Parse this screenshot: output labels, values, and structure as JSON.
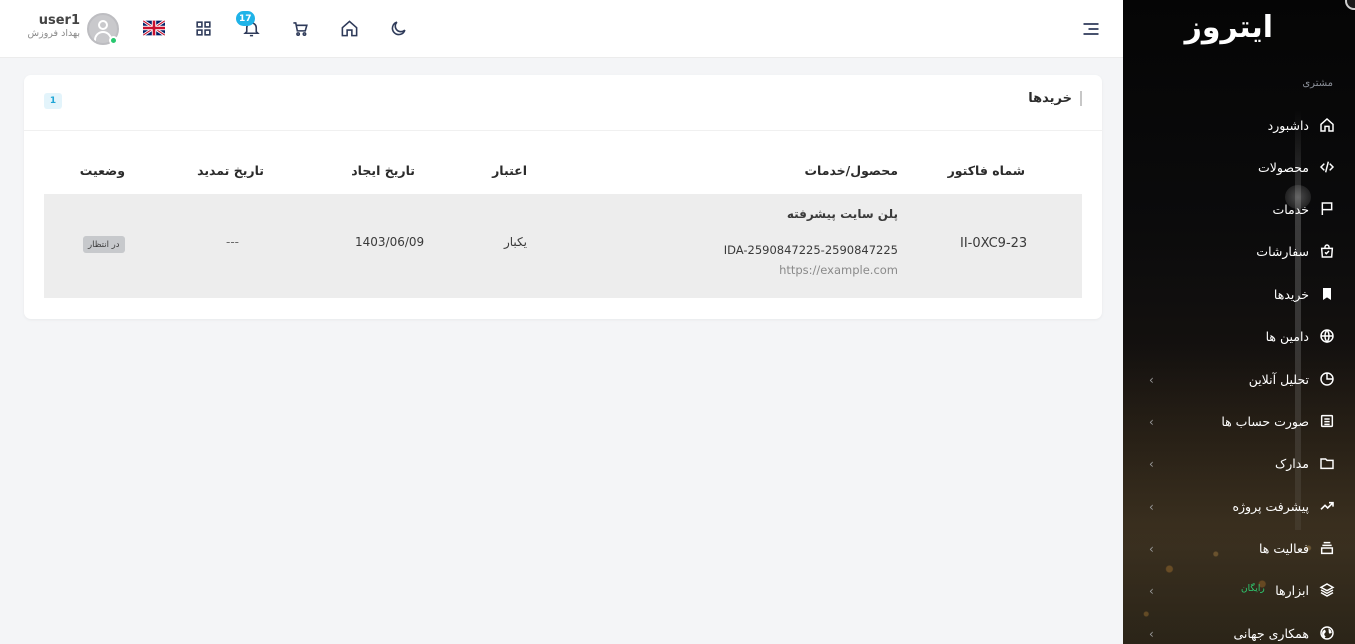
{
  "sidebar": {
    "logo": "ایتروز",
    "section_label": "مشتری",
    "items": [
      {
        "label": "داشبورد",
        "icon": "home-icon",
        "chevron": false
      },
      {
        "label": "محصولات",
        "icon": "code-icon",
        "chevron": false
      },
      {
        "label": "خدمات",
        "icon": "flag-icon",
        "chevron": false
      },
      {
        "label": "سفارشات",
        "icon": "shopping-bag-icon",
        "chevron": false
      },
      {
        "label": "خریدها",
        "icon": "bookmark-icon",
        "chevron": false
      },
      {
        "label": "دامین ها",
        "icon": "globe-icon",
        "chevron": false
      },
      {
        "label": "تحلیل آنلاین",
        "icon": "pie-chart-icon",
        "chevron": true
      },
      {
        "label": "صورت حساب ها",
        "icon": "invoice-icon",
        "chevron": true
      },
      {
        "label": "مدارک",
        "icon": "folder-icon",
        "chevron": true
      },
      {
        "label": "پیشرفت پروژه",
        "icon": "trending-up-icon",
        "chevron": true
      },
      {
        "label": "فعالیت ها",
        "icon": "archive-icon",
        "chevron": true
      },
      {
        "label": "ابزارها",
        "icon": "layers-icon",
        "chevron": true,
        "badge": "رایگان"
      },
      {
        "label": "همکاری جهانی",
        "icon": "world-icon",
        "chevron": true
      }
    ]
  },
  "topbar": {
    "notification_count": "17",
    "user": {
      "name": "user1",
      "role": "بهداد فروزش"
    },
    "language_icon": "uk-flag-icon"
  },
  "card": {
    "title": "خریدها",
    "count": "1",
    "columns": {
      "invoice": "شماه فاکتور",
      "product": "محصول/خدمات",
      "validity": "اعتبار",
      "created": "تاریخ ایجاد",
      "renewal": "تاریخ تمدید",
      "status": "وضعیت"
    },
    "rows": [
      {
        "invoice": "II-0XC9-23",
        "product_name": "پلن سایت پیشرفته",
        "product_id": "IDA-2590847225-2590847225",
        "product_url": "https://example.com",
        "validity": "یکبار",
        "created": "1403/06/09",
        "renewal": "---",
        "status": "در انتظار"
      }
    ]
  }
}
